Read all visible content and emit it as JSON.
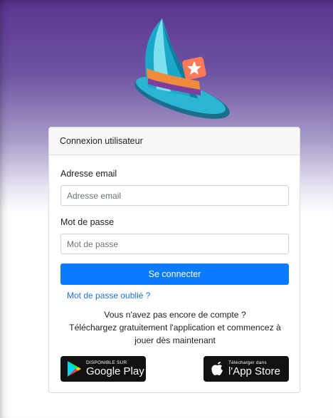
{
  "card": {
    "title": "Connexion utilisateur",
    "email_label": "Adresse email",
    "email_placeholder": "Adresse email",
    "email_value": "",
    "password_label": "Mot de passe",
    "password_placeholder": "Mot de passe",
    "password_value": "",
    "login_button": "Se connecter",
    "forgot_link": "Mot de passe oublié ?",
    "no_account_line1": "Vous n'avez pas encore de compte ?",
    "no_account_line2": "Téléchargez gratuitement l'application et commencez à",
    "no_account_line3": "jouer dès maintenant"
  },
  "stores": {
    "google_small": "DISPONIBLE SUR",
    "google_big": "Google Play",
    "apple_small": "Télécharger dans",
    "apple_big": "l'App Store"
  },
  "colors": {
    "primary": "#0a7bff",
    "link": "#1a73e8",
    "hero_top": "#5a3490"
  },
  "icons": {
    "logo": "wizard-hat-icon",
    "google": "google-play-icon",
    "apple": "apple-icon"
  }
}
